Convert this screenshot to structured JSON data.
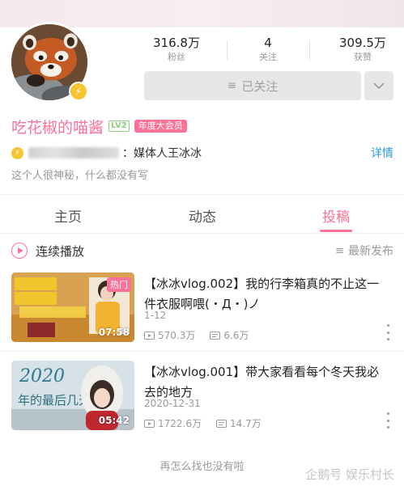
{
  "profile": {
    "name": "吃花椒的喵酱",
    "level_badge": "LV2",
    "vip_badge": "年度大会员",
    "auth_text": "：媒体人王冰冰",
    "detail_link": "详情",
    "bio": "这个人很神秘，什么都没有写"
  },
  "stats": [
    {
      "value": "316.8万",
      "label": "粉丝"
    },
    {
      "value": "4",
      "label": "关注"
    },
    {
      "value": "309.5万",
      "label": "获赞"
    }
  ],
  "follow_button": {
    "label": "已关注"
  },
  "tabs": [
    {
      "label": "主页"
    },
    {
      "label": "动态"
    },
    {
      "label": "投稿"
    }
  ],
  "active_tab_index": 2,
  "playlist": {
    "continuous_play_label": "连续播放",
    "sort_label": "最新发布"
  },
  "videos": [
    {
      "title": "【冰冰vlog.002】我的行李箱真的不止这一件衣服啊喂(・Д・)ノ",
      "date": "1-12",
      "views": "570.3万",
      "danmaku": "6.6万",
      "duration": "07:58",
      "hot_badge": "热门"
    },
    {
      "title": "【冰冰vlog.001】带大家看看每个冬天我必去的地方",
      "date": "2020-12-31",
      "views": "1722.6万",
      "danmaku": "14.7万",
      "duration": "05:42"
    }
  ],
  "footer_text": "再怎么找也没有啦",
  "watermark": "企鹅号 娱乐村长",
  "colors": {
    "accent_pink": "#fb7299",
    "link_blue": "#2b9ed8",
    "verify_yellow": "#f7c531",
    "level_green": "#8cd17a"
  }
}
